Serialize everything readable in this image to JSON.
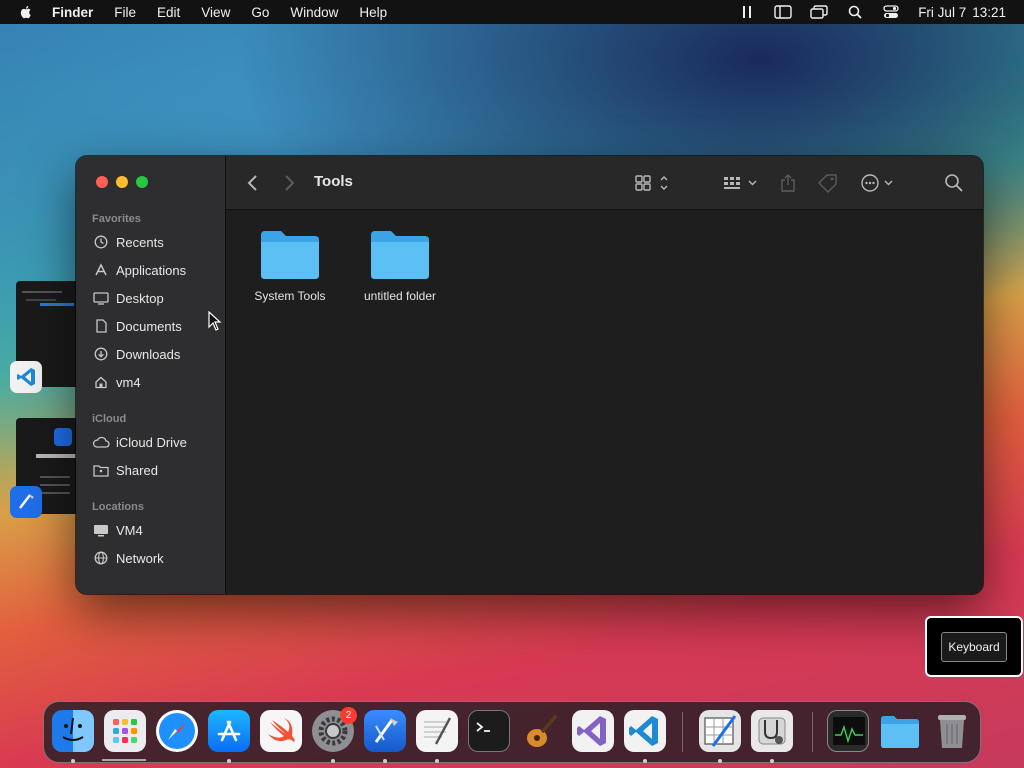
{
  "menubar": {
    "items": [
      "Finder",
      "File",
      "Edit",
      "View",
      "Go",
      "Window",
      "Help"
    ],
    "date": "Fri Jul 7",
    "time": "13:21"
  },
  "window": {
    "title": "Tools",
    "sidebar": {
      "favorites_label": "Favorites",
      "favorites": [
        {
          "label": "Recents",
          "icon": "clock-icon"
        },
        {
          "label": "Applications",
          "icon": "applications-icon"
        },
        {
          "label": "Desktop",
          "icon": "desktop-icon"
        },
        {
          "label": "Documents",
          "icon": "document-icon"
        },
        {
          "label": "Downloads",
          "icon": "download-icon"
        },
        {
          "label": "vm4",
          "icon": "home-icon"
        }
      ],
      "icloud_label": "iCloud",
      "icloud": [
        {
          "label": "iCloud Drive",
          "icon": "cloud-icon"
        },
        {
          "label": "Shared",
          "icon": "shared-folder-icon"
        }
      ],
      "locations_label": "Locations",
      "locations": [
        {
          "label": "VM4",
          "icon": "monitor-icon"
        },
        {
          "label": "Network",
          "icon": "globe-icon"
        }
      ]
    },
    "files": [
      {
        "name": "System Tools",
        "icon": "folder-icon"
      },
      {
        "name": "untitled folder",
        "icon": "folder-icon"
      }
    ]
  },
  "keyboard_hud": {
    "label": "Keyboard"
  },
  "dock": {
    "apps": [
      {
        "name": "Finder",
        "icon": "finder-icon",
        "color": "#2d8cf0"
      },
      {
        "name": "Launchpad",
        "icon": "launchpad-icon",
        "color": "#e8e8ec"
      },
      {
        "name": "Safari",
        "icon": "safari-icon",
        "color": "#1e90ff"
      },
      {
        "name": "App Store",
        "icon": "app-store-icon",
        "color": "#1a8cff"
      },
      {
        "name": "Swift Playgrounds",
        "icon": "swift-icon",
        "color": "#f5f5f5"
      },
      {
        "name": "System Settings",
        "icon": "gear-icon",
        "color": "#8e8e93",
        "badge": "2"
      },
      {
        "name": "Xcode",
        "icon": "xcode-icon",
        "color": "#1f6feb"
      },
      {
        "name": "TextEdit",
        "icon": "textedit-icon",
        "color": "#f4f4f4"
      },
      {
        "name": "Terminal",
        "icon": "terminal-icon",
        "color": "#1c1c1c"
      },
      {
        "name": "GarageBand",
        "icon": "guitar-icon",
        "color": "#3a3a3a"
      },
      {
        "name": "Visual Studio",
        "icon": "visual-studio-icon",
        "color": "#f2f2f2"
      },
      {
        "name": "Visual Studio Code",
        "icon": "vscode-icon",
        "color": "#f2f2f2"
      },
      {
        "name": "Instruments",
        "icon": "instruments-icon",
        "color": "#e5e5e5"
      },
      {
        "name": "Disk Utility",
        "icon": "disk-utility-icon",
        "color": "#e8e8e8"
      },
      {
        "name": "Activity Monitor",
        "icon": "activity-monitor-icon",
        "color": "#2a2a2a"
      },
      {
        "name": "Downloads",
        "icon": "folder-icon",
        "color": "#5ac8fa"
      },
      {
        "name": "Trash",
        "icon": "trash-icon",
        "color": "#9a9a9e"
      }
    ]
  }
}
